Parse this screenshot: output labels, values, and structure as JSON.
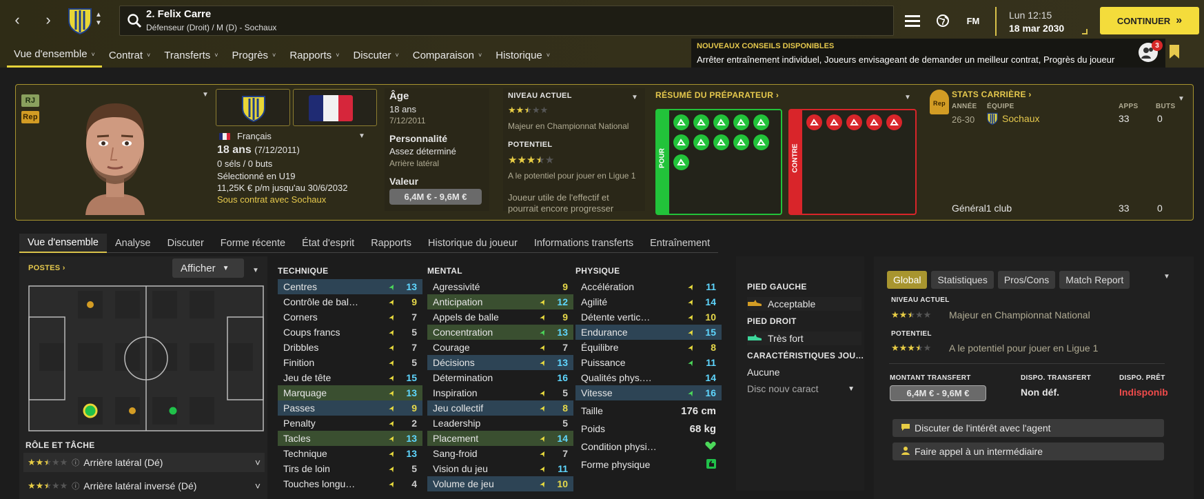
{
  "player": {
    "number_name": "2. Felix Carre",
    "subtitle": "Défenseur (Droit) / M (D) - Sochaux",
    "nationality": "Français",
    "age_line": "18 ans",
    "dob_paren": "(7/12/2011)",
    "caps": "0 séls / 0 buts",
    "selected": "Sélectionné en U19",
    "wage": "11,25K € p/m jusqu'au 30/6/2032",
    "contract": "Sous contrat avec Sochaux",
    "badge_rj": "RJ",
    "badge_rep": "Rep"
  },
  "header": {
    "time": "Lun 12:15",
    "date": "18 mar 2030",
    "fm": "FM",
    "continue": "CONTINUER",
    "notif_count": "3",
    "advice_title": "NOUVEAUX CONSEILS DISPONIBLES",
    "advice_text": "Arrêter entraînement individuel, Joueurs envisageant de demander un meilleur contrat, Progrès du joueur"
  },
  "tabs": [
    "Vue d'ensemble",
    "Contrat",
    "Transferts",
    "Progrès",
    "Rapports",
    "Discuter",
    "Comparaison",
    "Historique"
  ],
  "info": {
    "age_label": "Âge",
    "age_value": "18 ans",
    "dob": "7/12/2011",
    "personality_label": "Personnalité",
    "personality_value": "Assez déterminé",
    "role": "Arrière latéral",
    "value_label": "Valeur",
    "value_range": "6,4M € - 9,6M €"
  },
  "ability": {
    "current_label": "NIVEAU ACTUEL",
    "current_text": "Majeur en Championnat National",
    "current_stars": 2.5,
    "potential_label": "POTENTIEL",
    "potential_text": "A le potentiel pour jouer en Ligue 1",
    "potential_stars": 3.5,
    "summary": "Joueur utile de l'effectif et pourrait encore progresser"
  },
  "coach": {
    "title": "RÉSUMÉ DU PRÉPARATEUR",
    "pour": "POUR",
    "contre": "CONTRE",
    "pour_icons": [
      "heading-icon",
      "tackle-icon",
      "run-icon",
      "jump-icon",
      "flask-icon",
      "trend-icon",
      "brain-icon",
      "boot-icon",
      "pace-icon",
      "clipboard-icon",
      "document-icon"
    ],
    "contre_icons": [
      "star-icon",
      "target-icon",
      "shot-icon",
      "shield-icon",
      "rocket-icon"
    ]
  },
  "career": {
    "title": "STATS CARRIÈRE",
    "col_year": "ANNÉE",
    "col_team": "ÉQUIPE",
    "col_apps": "APPS",
    "col_goals": "BUTS",
    "row_year": "26-30",
    "row_team": "Sochaux",
    "row_apps": "33",
    "row_goals": "0",
    "total_label": "Général1 club",
    "total_apps": "33",
    "total_goals": "0",
    "rep": "Rep"
  },
  "subtabs": [
    "Vue d'ensemble",
    "Analyse",
    "Discuter",
    "Forme récente",
    "État d'esprit",
    "Rapports",
    "Historique du joueur",
    "Informations transferts",
    "Entraînement"
  ],
  "positions": {
    "title": "POSTES",
    "show": "Afficher",
    "role_title": "RÔLE ET TÂCHE",
    "roles": [
      {
        "name": "Arrière latéral (Dé)",
        "stars": 2.5
      },
      {
        "name": "Arrière latéral inversé (Dé)",
        "stars": 2.5
      }
    ]
  },
  "technique": {
    "title": "TECHNIQUE",
    "rows": [
      {
        "n": "Centres",
        "v": "13",
        "hl": "blue",
        "up": "g"
      },
      {
        "n": "Contrôle de bal…",
        "v": "9",
        "hl": "",
        "up": "y"
      },
      {
        "n": "Corners",
        "v": "7",
        "hl": "",
        "up": "y"
      },
      {
        "n": "Coups francs",
        "v": "5",
        "hl": "",
        "up": "y"
      },
      {
        "n": "Dribbles",
        "v": "7",
        "hl": "",
        "up": "y"
      },
      {
        "n": "Finition",
        "v": "5",
        "hl": "",
        "up": "y"
      },
      {
        "n": "Jeu de tête",
        "v": "15",
        "hl": "",
        "up": "y"
      },
      {
        "n": "Marquage",
        "v": "13",
        "hl": "green",
        "up": "y"
      },
      {
        "n": "Passes",
        "v": "9",
        "hl": "blue",
        "up": "y"
      },
      {
        "n": "Penalty",
        "v": "2",
        "hl": "",
        "up": "y"
      },
      {
        "n": "Tacles",
        "v": "13",
        "hl": "green",
        "up": "y"
      },
      {
        "n": "Technique",
        "v": "13",
        "hl": "",
        "up": "y"
      },
      {
        "n": "Tirs de loin",
        "v": "5",
        "hl": "",
        "up": "y"
      },
      {
        "n": "Touches longu…",
        "v": "4",
        "hl": "",
        "up": "y"
      }
    ]
  },
  "mental": {
    "title": "MENTAL",
    "rows": [
      {
        "n": "Agressivité",
        "v": "9",
        "hl": "",
        "up": ""
      },
      {
        "n": "Anticipation",
        "v": "12",
        "hl": "green",
        "up": "y"
      },
      {
        "n": "Appels de balle",
        "v": "9",
        "hl": "",
        "up": "y"
      },
      {
        "n": "Concentration",
        "v": "13",
        "hl": "green",
        "up": "g"
      },
      {
        "n": "Courage",
        "v": "7",
        "hl": "",
        "up": "y"
      },
      {
        "n": "Décisions",
        "v": "13",
        "hl": "blue",
        "up": "y"
      },
      {
        "n": "Détermination",
        "v": "16",
        "hl": "",
        "up": ""
      },
      {
        "n": "Inspiration",
        "v": "5",
        "hl": "",
        "up": "y"
      },
      {
        "n": "Jeu collectif",
        "v": "8",
        "hl": "blue",
        "up": "y"
      },
      {
        "n": "Leadership",
        "v": "5",
        "hl": "",
        "up": ""
      },
      {
        "n": "Placement",
        "v": "14",
        "hl": "green",
        "up": "y"
      },
      {
        "n": "Sang-froid",
        "v": "7",
        "hl": "",
        "up": "y"
      },
      {
        "n": "Vision du jeu",
        "v": "11",
        "hl": "",
        "up": "y"
      },
      {
        "n": "Volume de jeu",
        "v": "10",
        "hl": "blue",
        "up": "y"
      }
    ]
  },
  "physique": {
    "title": "PHYSIQUE",
    "rows": [
      {
        "n": "Accélération",
        "v": "11",
        "hl": "",
        "up": "y"
      },
      {
        "n": "Agilité",
        "v": "14",
        "hl": "",
        "up": "y"
      },
      {
        "n": "Détente vertic…",
        "v": "10",
        "hl": "",
        "up": "y"
      },
      {
        "n": "Endurance",
        "v": "15",
        "hl": "blue",
        "up": "y"
      },
      {
        "n": "Équilibre",
        "v": "8",
        "hl": "",
        "up": "y"
      },
      {
        "n": "Puissance",
        "v": "11",
        "hl": "",
        "up": "g"
      },
      {
        "n": "Qualités phys.…",
        "v": "14",
        "hl": "",
        "up": ""
      },
      {
        "n": "Vitesse",
        "v": "16",
        "hl": "blue",
        "up": "g"
      }
    ],
    "height_label": "Taille",
    "height": "176 cm",
    "weight_label": "Poids",
    "weight": "68 kg",
    "condition_label": "Condition physi…",
    "form_label": "Forme physique"
  },
  "feet": {
    "left_label": "PIED GAUCHE",
    "left_value": "Acceptable",
    "right_label": "PIED DROIT",
    "right_value": "Très fort",
    "traits_label": "CARACTÉRISTIQUES JOU…",
    "traits_value": "Aucune",
    "traits_select": "Disc nouv caract"
  },
  "overview": {
    "tabs": [
      "Global",
      "Statistiques",
      "Pros/Cons",
      "Match Report"
    ],
    "current_label": "NIVEAU ACTUEL",
    "current_text": "Majeur en Championnat National",
    "potential_label": "POTENTIEL",
    "potential_text": "A le potentiel pour jouer en Ligue 1",
    "transfer_label": "MONTANT TRANSFERT",
    "transfer_value": "6,4M € - 9,6M €",
    "dispo_t_label": "DISPO. TRANSFERT",
    "dispo_t_value": "Non déf.",
    "dispo_p_label": "DISPO. PRÊT",
    "dispo_p_value": "Indisponib",
    "action1": "Discuter de l'intérêt avec l'agent",
    "action2": "Faire appel à un intermédiaire"
  },
  "colors": {
    "accent": "#f4dc3b",
    "pour": "#22c33a",
    "contre": "#d9252a",
    "high": "#5fd7ff",
    "mid": "#e6d84a"
  }
}
